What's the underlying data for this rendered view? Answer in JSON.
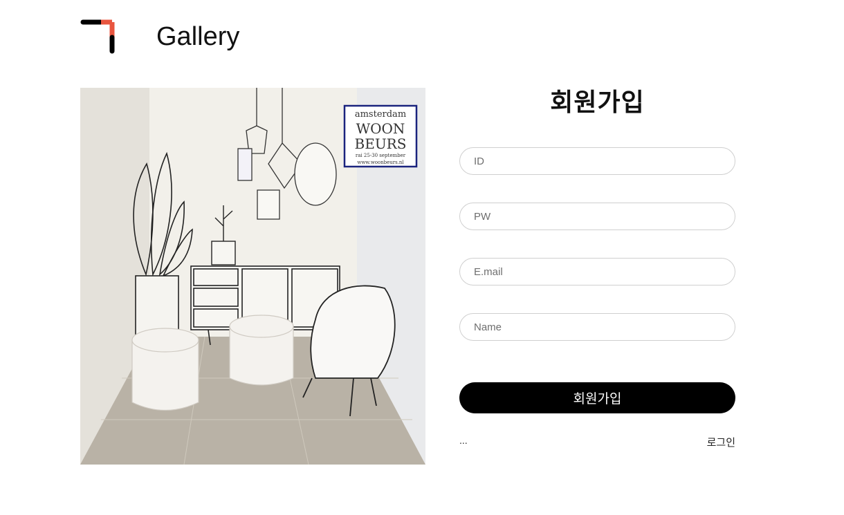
{
  "header": {
    "brand": "Gallery",
    "logo_colors": {
      "accent": "#e8553f",
      "dark": "#000000"
    }
  },
  "hero_image": {
    "sign_line1": "amsterdam",
    "sign_line2": "WOON",
    "sign_line3": "BEURS",
    "sign_line4": "rai 25-30 september",
    "sign_line5": "www.woonbeurs.nl"
  },
  "signup": {
    "title": "회원가입",
    "fields": [
      {
        "placeholder": "ID"
      },
      {
        "placeholder": "PW"
      },
      {
        "placeholder": "E.mail"
      },
      {
        "placeholder": "Name"
      }
    ],
    "submit_label": "회원가입",
    "footer_left": "...",
    "footer_right": "로그인"
  }
}
